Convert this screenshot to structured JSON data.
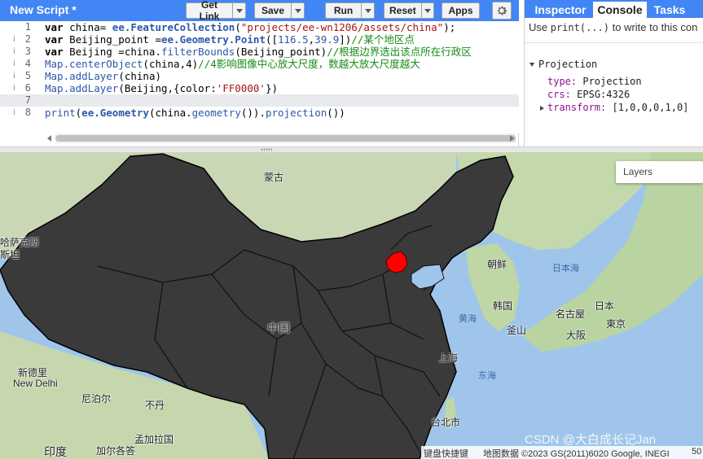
{
  "toolbar": {
    "script_title": "New Script *",
    "get_link_label": "Get Link",
    "save_label": "Save",
    "run_label": "Run",
    "reset_label": "Reset",
    "apps_label": "Apps",
    "settings_icon": "gear-icon"
  },
  "code_lines": [
    {
      "num": "1",
      "tokens": [
        [
          "kw",
          "var"
        ],
        [
          "pl",
          " china= "
        ],
        [
          "fnb",
          "ee.FeatureCollection"
        ],
        [
          "pl",
          "("
        ],
        [
          "str",
          "\"projects/ee-wn1206/assets/china\""
        ],
        [
          "pl",
          ");"
        ]
      ]
    },
    {
      "num": "2",
      "tokens": [
        [
          "kw",
          "var"
        ],
        [
          "pl",
          " Beijing_point ="
        ],
        [
          "fnb",
          "ee.Geometry.Point"
        ],
        [
          "pl",
          "(["
        ],
        [
          "num",
          "116.5"
        ],
        [
          "pl",
          ","
        ],
        [
          "num",
          "39.9"
        ],
        [
          "pl",
          "])"
        ],
        [
          "cmt",
          "//某个地区点"
        ]
      ]
    },
    {
      "num": "3",
      "tokens": [
        [
          "kw",
          "var"
        ],
        [
          "pl",
          " Beijing =china."
        ],
        [
          "fn",
          "filterBounds"
        ],
        [
          "pl",
          "(Beijing_point)"
        ],
        [
          "cmt",
          "//根据边界选出该点所在行政区"
        ]
      ]
    },
    {
      "num": "4",
      "tokens": [
        [
          "fn",
          "Map.centerObject"
        ],
        [
          "pl",
          "(china,4)"
        ],
        [
          "cmt",
          "//4影响图像中心放大尺度，数越大放大尺度越大"
        ]
      ]
    },
    {
      "num": "5",
      "tokens": [
        [
          "fn",
          "Map.addLayer"
        ],
        [
          "pl",
          "(china)"
        ]
      ]
    },
    {
      "num": "6",
      "tokens": [
        [
          "fn",
          "Map.addLayer"
        ],
        [
          "pl",
          "(Beijing,{color:"
        ],
        [
          "str",
          "'FF0000'"
        ],
        [
          "pl",
          "})"
        ]
      ]
    },
    {
      "num": "7",
      "tokens": []
    },
    {
      "num": "8",
      "tokens": [
        [
          "fn",
          "print"
        ],
        [
          "pl",
          "("
        ],
        [
          "fnb",
          "ee.Geometry"
        ],
        [
          "pl",
          "(china."
        ],
        [
          "fn",
          "geometry"
        ],
        [
          "pl",
          "())."
        ],
        [
          "fn",
          "projection"
        ],
        [
          "pl",
          "())"
        ]
      ]
    }
  ],
  "right_panel": {
    "tabs": [
      "Inspector",
      "Console",
      "Tasks"
    ],
    "active_tab": "Console",
    "console_hint_prefix": "Use ",
    "console_hint_code": "print(...)",
    "console_hint_suffix": " to write to this con",
    "projection": {
      "title": "Projection",
      "type_key": "type:",
      "type_val": "Projection",
      "crs_key": "crs:",
      "crs_val": "EPSG:4326",
      "transform_key": "transform:",
      "transform_val": "[1,0,0,0,1,0]"
    }
  },
  "map": {
    "layers_label": "Layers",
    "labels": {
      "mongolia": "蒙古",
      "kazakh": "哈萨克斯",
      "kazakh2": "斯坦",
      "china": "中国",
      "north_korea": "朝鲜",
      "south_korea": "韩国",
      "busan": "釜山",
      "japan": "日本",
      "tokyo": "東京",
      "nagoya": "名古屋",
      "osaka": "大阪",
      "new_delhi_cn": "新德里",
      "new_delhi_en": "New Delhi",
      "kathmandu": "尼泊尔",
      "bhutan": "不丹",
      "bangladesh": "孟加拉国",
      "kolkata": "加尔各答",
      "india": "印度",
      "taipei": "台北市",
      "shanghai": "上海"
    },
    "seas": {
      "sea_of_japan": "日本海",
      "yellow_sea": "黄海",
      "east_china_sea": "东海"
    },
    "attribution": {
      "shortcuts": "键盘快捷键",
      "map_data": "地图数据 ©2023 GS(2011)6020 Google, INEGI",
      "scale": "50"
    },
    "watermark": "CSDN @大白成长记Jan",
    "colors": {
      "china_fill": "#3a3a3a",
      "beijing_fill": "#ff0000",
      "ocean": "#9fc6ea",
      "land": "#b7d3a8"
    }
  }
}
